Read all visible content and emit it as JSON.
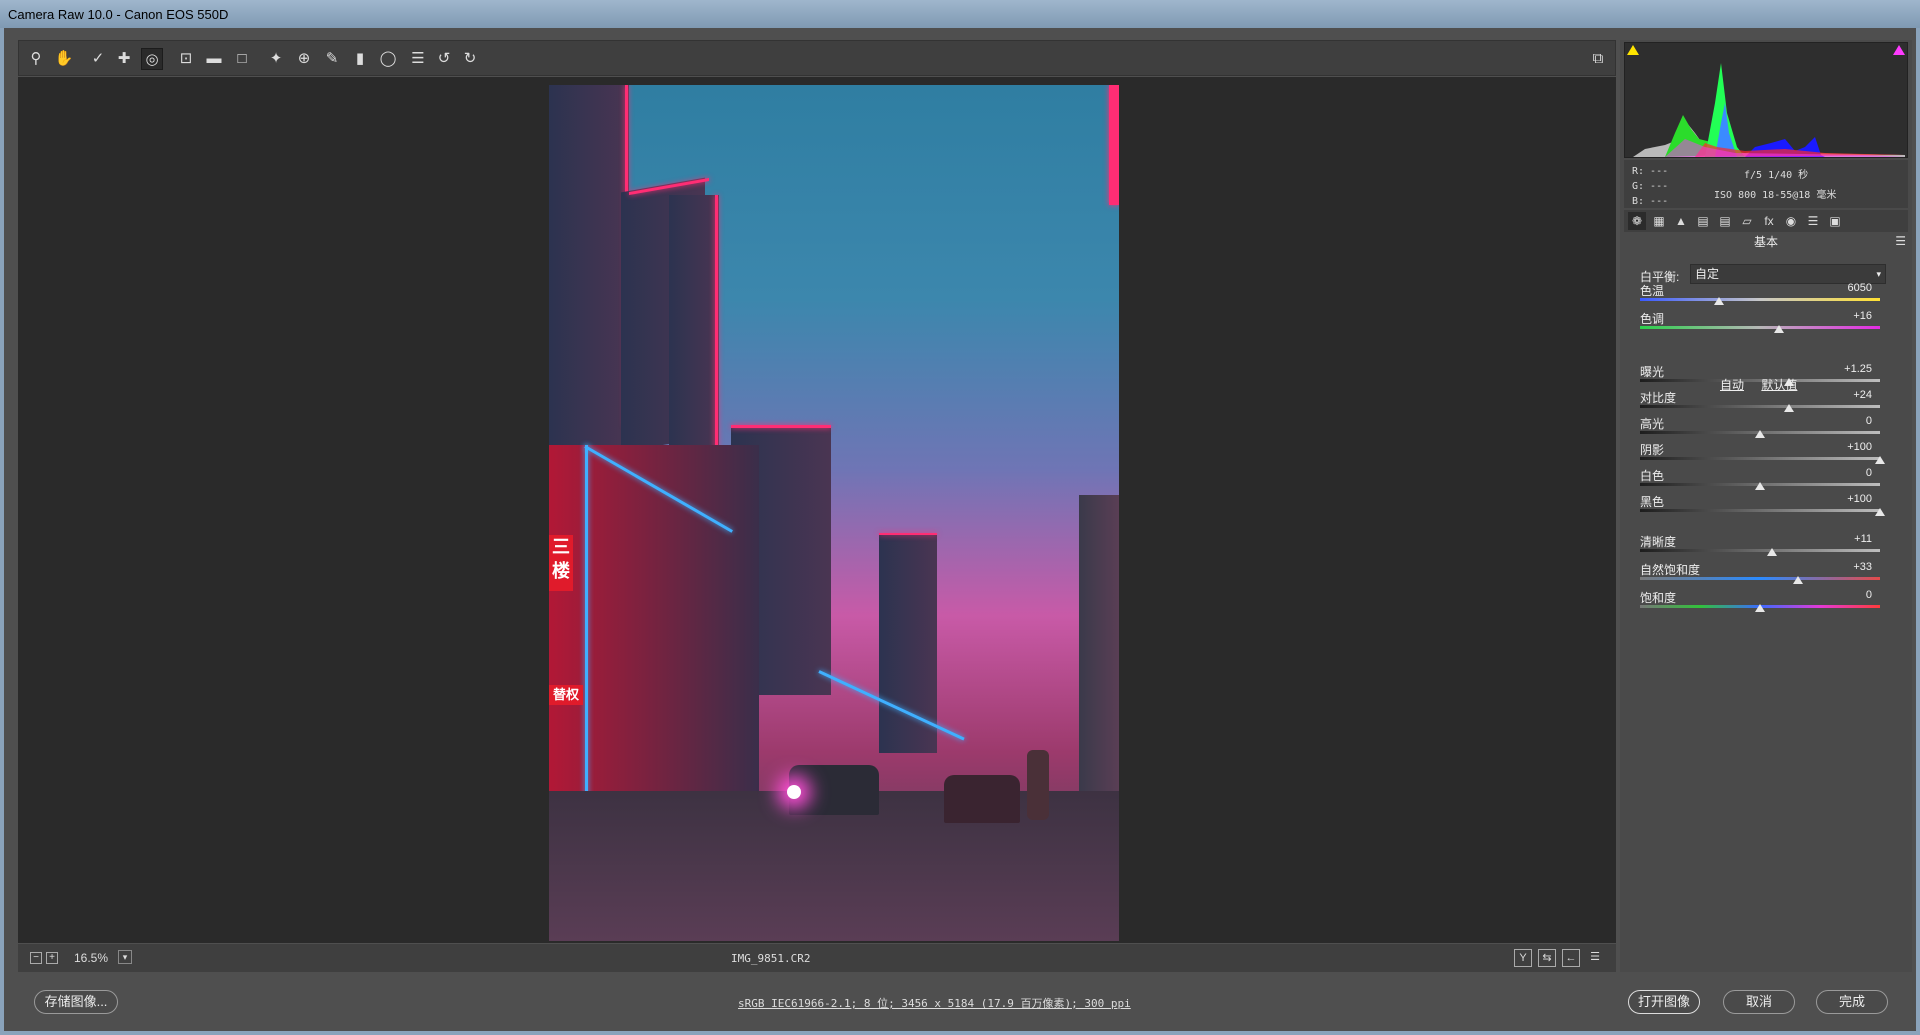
{
  "window": {
    "title": "Camera Raw 10.0 -  Canon EOS 550D"
  },
  "toolbar": {
    "tools": [
      "zoom-tool",
      "hand-tool",
      "white-balance-tool",
      "color-sampler-tool",
      "targeted-adjustment-tool",
      "crop-tool",
      "straighten-tool",
      "transform-tool",
      "spot-removal-tool",
      "red-eye-tool",
      "adjustment-brush-tool",
      "graduated-filter-tool",
      "radial-filter-tool",
      "preferences",
      "rotate-ccw",
      "rotate-cw"
    ]
  },
  "preview": {
    "zoom": "16.5%",
    "filename": "IMG_9851.CR2"
  },
  "photo_signs": {
    "left_sign": "三\n楼",
    "mid_sign": "替权"
  },
  "bottom": {
    "save_label": "存储图像...",
    "workflow_link": "sRGB IEC61966-2.1; 8 位; 3456 x 5184 (17.9 百万像素); 300 ppi",
    "open_label": "打开图像",
    "cancel_label": "取消",
    "done_label": "完成"
  },
  "info": {
    "r": "R:  ---",
    "g": "G:  ---",
    "b": "B:  ---",
    "line1": "f/5   1/40 秒",
    "line2": "ISO 800   18-55@18 毫米"
  },
  "panel": {
    "title": "基本",
    "wb_label": "白平衡:",
    "wb_value": "自定",
    "auto_label": "自动",
    "default_label": "默认值",
    "sliders": [
      {
        "label": "色温",
        "value": "6050",
        "pos": 0.33
      },
      {
        "label": "色调",
        "value": "+16",
        "pos": 0.58
      },
      {
        "label": "曝光",
        "value": "+1.25",
        "pos": 0.62
      },
      {
        "label": "对比度",
        "value": "+24",
        "pos": 0.62
      },
      {
        "label": "高光",
        "value": "0",
        "pos": 0.5
      },
      {
        "label": "阴影",
        "value": "+100",
        "pos": 1.0
      },
      {
        "label": "白色",
        "value": "0",
        "pos": 0.5
      },
      {
        "label": "黑色",
        "value": "+100",
        "pos": 1.0
      },
      {
        "label": "清晰度",
        "value": "+11",
        "pos": 0.55
      },
      {
        "label": "自然饱和度",
        "value": "+33",
        "pos": 0.66
      },
      {
        "label": "饱和度",
        "value": "0",
        "pos": 0.5
      }
    ]
  },
  "colors": {
    "accent_pink": "#ff2d74",
    "accent_blue": "#3fb0ff",
    "panel_bg": "#4a4a4a",
    "preview_bg": "#2a2a2a"
  }
}
